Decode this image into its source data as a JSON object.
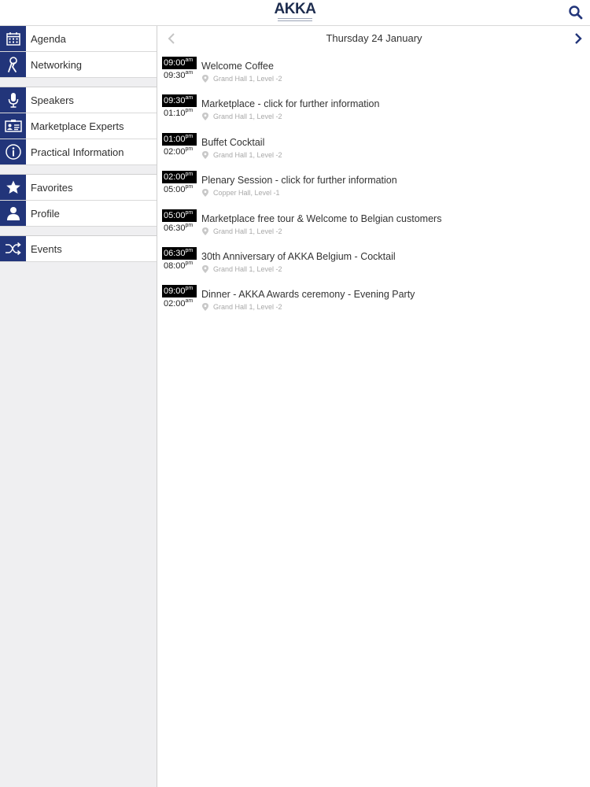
{
  "header": {
    "logo_text": "AKKA",
    "search_icon": "search-icon"
  },
  "sidebar": {
    "items": [
      {
        "label": "Agenda",
        "icon": "calendar-icon"
      },
      {
        "label": "Networking",
        "icon": "networking-icon"
      },
      {
        "label": "Speakers",
        "icon": "microphone-icon"
      },
      {
        "label": "Marketplace Experts",
        "icon": "id-card-icon"
      },
      {
        "label": "Practical Information",
        "icon": "info-icon"
      },
      {
        "label": "Favorites",
        "icon": "star-icon"
      },
      {
        "label": "Profile",
        "icon": "person-icon"
      },
      {
        "label": "Events",
        "icon": "shuffle-icon"
      }
    ]
  },
  "agenda": {
    "date": "Thursday 24 January",
    "sessions": [
      {
        "start": "09:00",
        "start_ampm": "am",
        "end": "09:30",
        "end_ampm": "am",
        "title": "Welcome Coffee",
        "location": "Grand Hall 1, Level -2"
      },
      {
        "start": "09:30",
        "start_ampm": "am",
        "end": "01:10",
        "end_ampm": "pm",
        "title": "Marketplace - click for further information",
        "location": "Grand Hall 1, Level -2"
      },
      {
        "start": "01:00",
        "start_ampm": "pm",
        "end": "02:00",
        "end_ampm": "pm",
        "title": "Buffet Cocktail",
        "location": "Grand Hall 1, Level -2"
      },
      {
        "start": "02:00",
        "start_ampm": "pm",
        "end": "05:00",
        "end_ampm": "pm",
        "title": "Plenary Session - click for further information",
        "location": "Copper Hall, Level -1"
      },
      {
        "start": "05:00",
        "start_ampm": "pm",
        "end": "06:30",
        "end_ampm": "pm",
        "title": "Marketplace free tour & Welcome to Belgian customers",
        "location": "Grand Hall 1, Level -2"
      },
      {
        "start": "06:30",
        "start_ampm": "pm",
        "end": "08:00",
        "end_ampm": "pm",
        "title": "30th Anniversary of AKKA Belgium - Cocktail",
        "location": "Grand Hall 1, Level -2"
      },
      {
        "start": "09:00",
        "start_ampm": "pm",
        "end": "02:00",
        "end_ampm": "am",
        "title": "Dinner - AKKA Awards ceremony - Evening Party",
        "location": "Grand Hall 1, Level -2"
      }
    ]
  },
  "colors": {
    "accent": "#22357a",
    "time_badge": "#000000"
  }
}
